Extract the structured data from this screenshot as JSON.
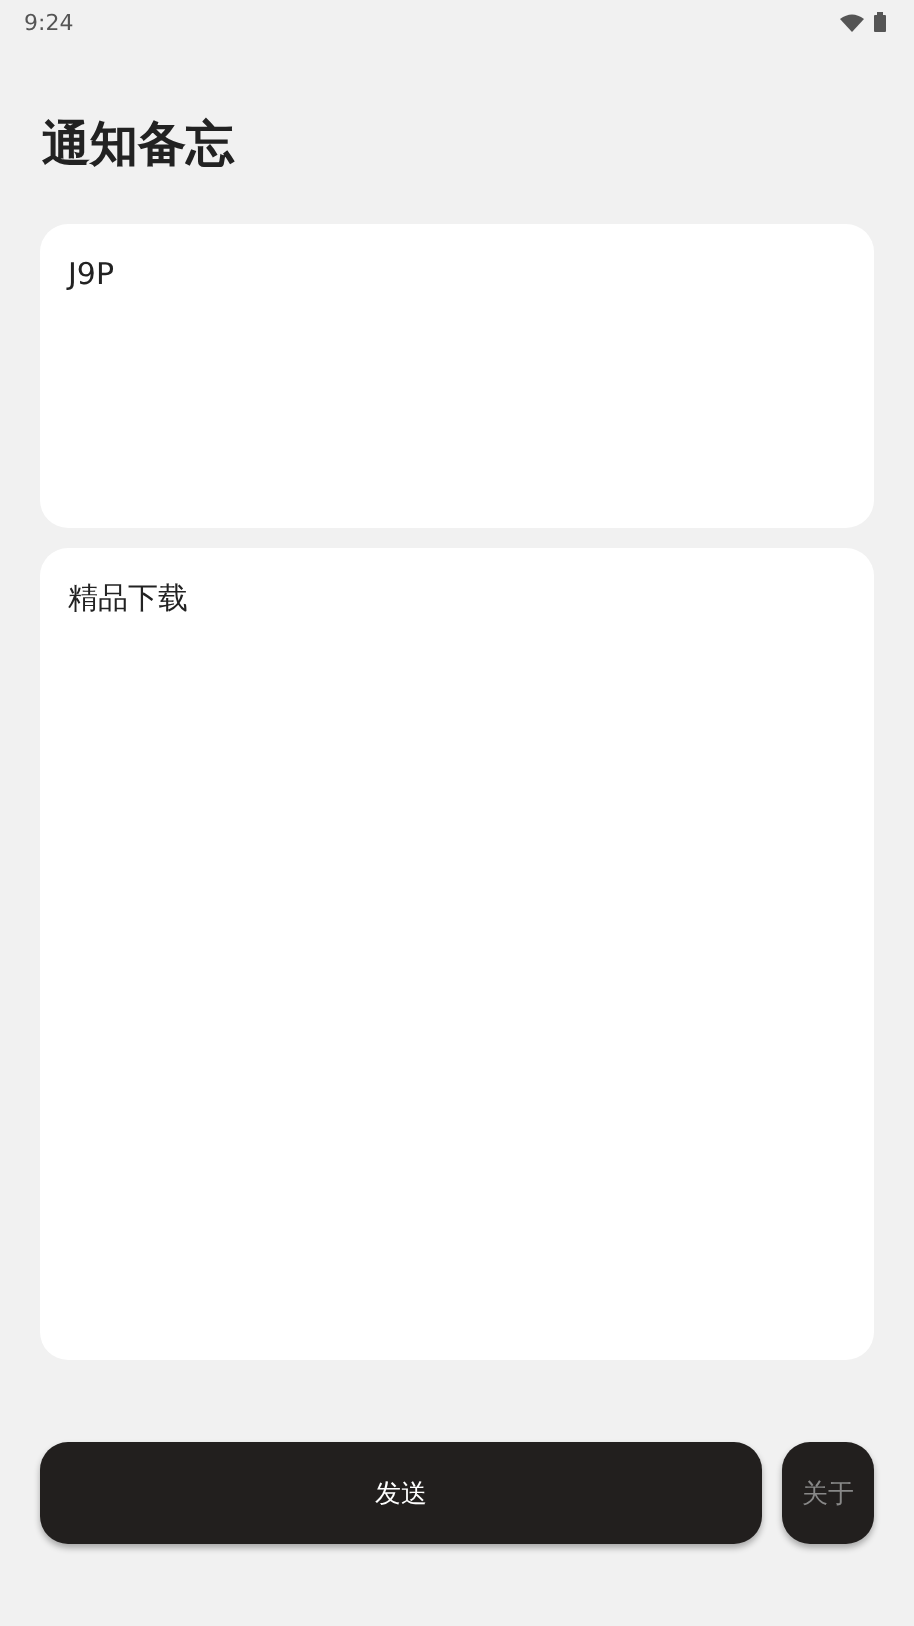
{
  "status_bar": {
    "time": "9:24"
  },
  "title": "通知备忘",
  "title_field": {
    "value": "J9P"
  },
  "content_field": {
    "value": "精品下载"
  },
  "buttons": [
    {
      "label": "发送",
      "kind": "primary"
    },
    {
      "label": "关于",
      "kind": "secondary"
    }
  ]
}
